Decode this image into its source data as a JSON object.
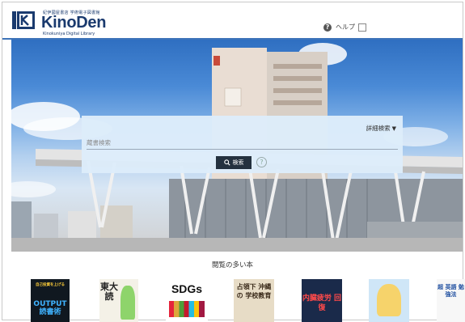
{
  "header": {
    "logo_subtitle_top": "紀伊國屋書店 学術電子図書館",
    "logo_title": "KinoDen",
    "logo_subtitle_bottom": "Kinokuniya Digital Library",
    "help_label": "ヘルプ"
  },
  "search": {
    "advanced_label": "詳細検索",
    "placeholder": "蔵書検索",
    "button_label": "検索"
  },
  "popular": {
    "title": "閲覧の多い本"
  },
  "books": [
    {
      "cover_text": "OUTPUT 読書術",
      "top_text": "自己投資を上げる"
    },
    {
      "cover_text": "東大 読"
    },
    {
      "cover_text": "SDGs"
    },
    {
      "cover_text": "占領下 沖縄の 学校教育"
    },
    {
      "cover_text": "内臓疲労 回復"
    },
    {
      "cover_text": ""
    },
    {
      "cover_text": "超 英語 勉強法"
    }
  ],
  "colors": {
    "brand": "#1a3a6e",
    "accent_line": "#3d73b8",
    "search_button": "#24313f",
    "panel": "#ddecfa"
  }
}
